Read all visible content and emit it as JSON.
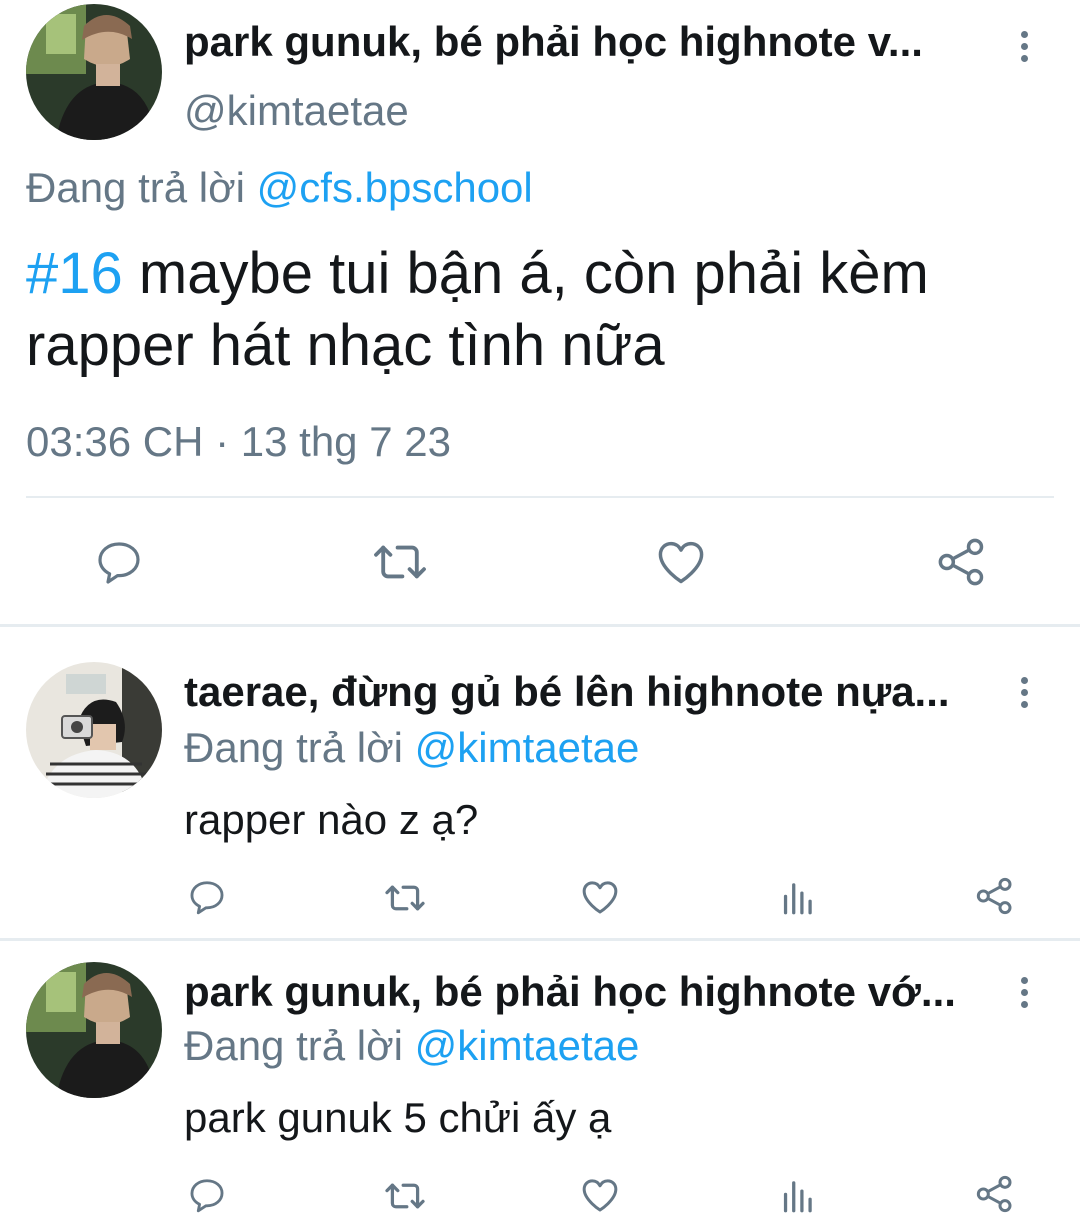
{
  "main_tweet": {
    "display_name": "park gunuk, bé phải học highnote v...",
    "handle": "@kimtaetae",
    "reply_prefix": "Đang trả lời",
    "reply_to": "@cfs.bpschool",
    "hashtag": "#16",
    "text_line1": " maybe tui bận á, còn phải kèm",
    "text_line2": "rapper hát nhạc tình nữa",
    "timestamp": "03:36 CH · 13 thg 7 23"
  },
  "replies": [
    {
      "display_name": "taerae, đừng gủ bé lên highnote nựa...",
      "reply_prefix": "Đang trả lời",
      "reply_to": "@kimtaetae",
      "text": "rapper nào z ạ?"
    },
    {
      "display_name": "park gunuk, bé phải học highnote vớ...",
      "reply_prefix": "Đang trả lời",
      "reply_to": "@kimtaetae",
      "text": "park gunuk 5 chửi ấy ạ"
    }
  ],
  "icons": {
    "reply": "reply-icon",
    "retweet": "retweet-icon",
    "like": "heart-icon",
    "stats": "analytics-icon",
    "share": "share-icon",
    "more": "more-vertical-icon"
  },
  "colors": {
    "link": "#1da1f2",
    "secondary": "#657786",
    "icon": "#657786",
    "divider": "#e6ecf0"
  }
}
